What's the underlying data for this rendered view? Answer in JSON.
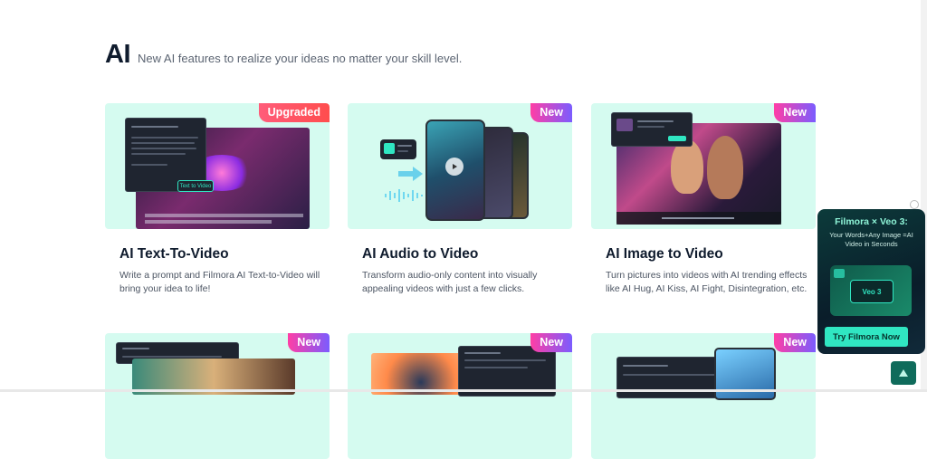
{
  "section": {
    "title": "AI",
    "subtitle": "New AI features to realize your ideas no matter your skill level."
  },
  "cards": [
    {
      "badge": "Upgraded",
      "title": "AI Text-To-Video",
      "desc": "Write a prompt and Filmora AI Text-to-Video will bring your idea to life!",
      "mock_button": "Text to Video"
    },
    {
      "badge": "New",
      "title": "AI Audio to Video",
      "desc": "Transform audio-only content into visually appealing videos with just a few clicks."
    },
    {
      "badge": "New",
      "title": "AI Image to Video",
      "desc": "Turn pictures into videos with AI trending effects like AI Hug, AI Kiss, AI Fight, Disintegration, etc."
    },
    {
      "badge": "New"
    },
    {
      "badge": "New"
    },
    {
      "badge": "New"
    }
  ],
  "ad": {
    "title": "Filmora × Veo 3:",
    "subtitle": "Your Words+Any Image =AI Video in Seconds",
    "badge_text": "Veo 3",
    "button": "Try Filmora Now"
  },
  "icons": {
    "back_to_top": "arrow-up-icon",
    "close": "close-icon"
  },
  "colors": {
    "mint": "#d5fbf0",
    "badge_new_start": "#ff3ea5",
    "badge_new_end": "#7b5cff",
    "cta": "#30e6c2"
  }
}
